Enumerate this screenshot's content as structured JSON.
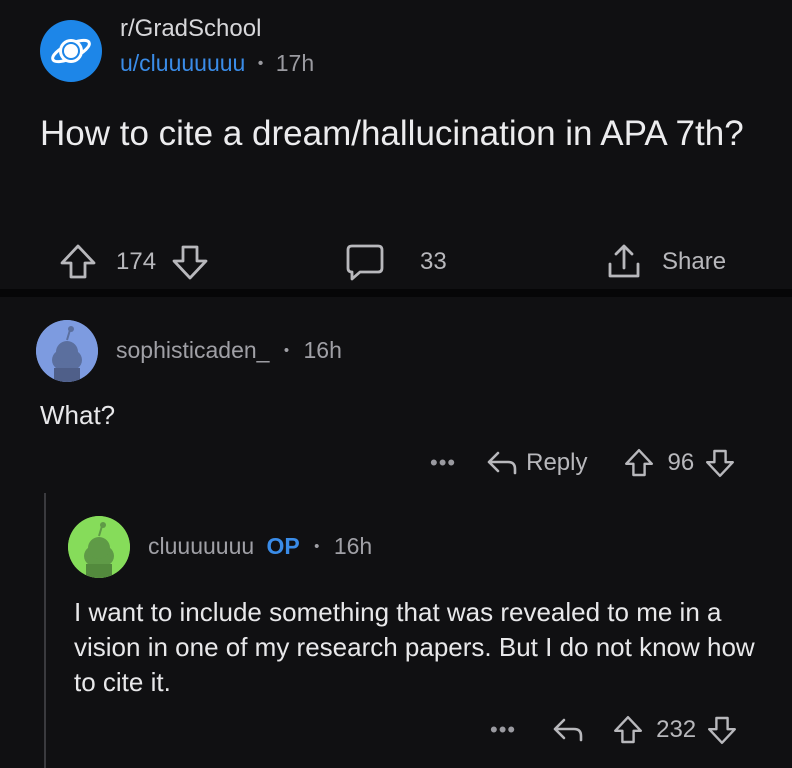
{
  "post": {
    "subreddit": "r/GradSchool",
    "username": "u/cluuuuuuu",
    "separator": "•",
    "age": "17h",
    "title": "How to cite a dream/hallucination in APA 7th?",
    "upvotes": "174",
    "comments": "33",
    "share_label": "Share"
  },
  "comments": [
    {
      "author": "sophisticaden_",
      "separator": "•",
      "age": "16h",
      "body": "What?",
      "more": "•••",
      "reply_label": "Reply",
      "score": "96",
      "avatar_color": "#7d9be0"
    },
    {
      "author": "cluuuuuuu",
      "op_tag": "OP",
      "separator": "•",
      "age": "16h",
      "body": "I want to include something that was revealed to me in a vision in one of my research papers. But I do not know how to cite it.",
      "more": "•••",
      "score": "232",
      "avatar_color": "#86dc5a"
    }
  ],
  "colors": {
    "background": "#101012",
    "accent": "#3a8ce8",
    "subreddit_icon": "#1d86e8"
  }
}
